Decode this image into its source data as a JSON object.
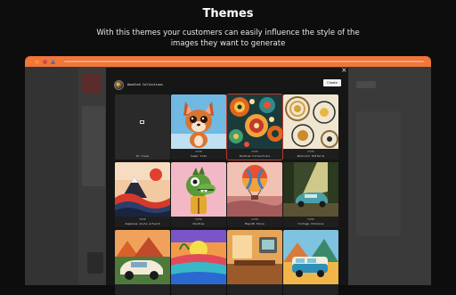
{
  "hero": {
    "title": "Themes",
    "subtitle": "With this themes your customers can easily influence the style of the images they want to generate"
  },
  "window": {
    "titlebar_color": "#f0763a",
    "controls": [
      "orange-dot",
      "red-dot",
      "blue-triangle"
    ]
  },
  "modal": {
    "close_label": "×",
    "collection_name": "Doodled Collections",
    "create_label": "Create",
    "no_theme_label": "No theme",
    "themes": [
      {
        "tag": "THEME",
        "title": "Super Cute"
      },
      {
        "tag": "THEME",
        "title": "Doodled Collections",
        "selected": true
      },
      {
        "tag": "THEME",
        "title": "Abstract Patterns"
      },
      {
        "tag": "THEME",
        "title": "Japanese style artwork"
      },
      {
        "tag": "THEME",
        "title": "Doodles"
      },
      {
        "tag": "THEME",
        "title": "Map/2D Style"
      },
      {
        "tag": "THEME",
        "title": "Vintage Vibrance"
      }
    ]
  },
  "colors": {
    "accent": "#f0763a",
    "selected_border": "#c0392b",
    "modal_bg": "#161616"
  }
}
